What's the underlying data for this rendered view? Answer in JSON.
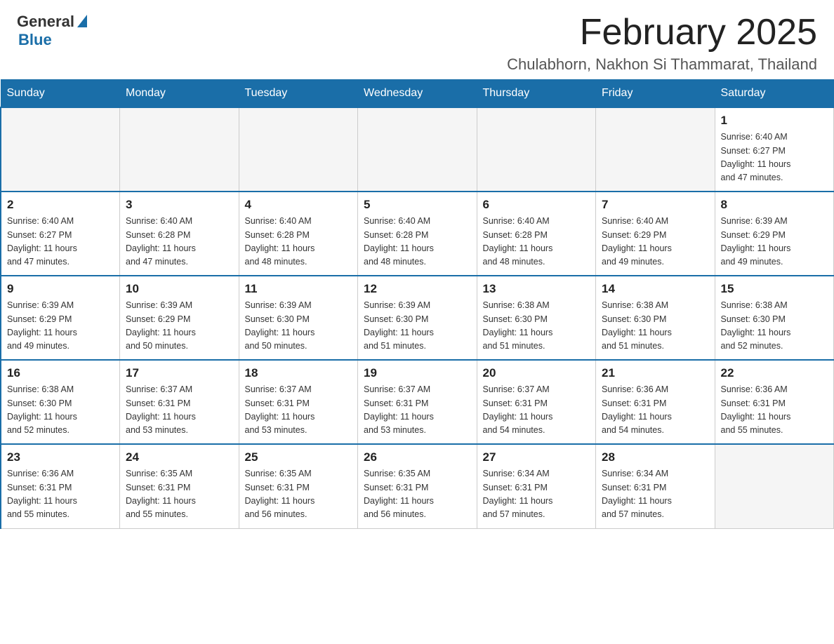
{
  "header": {
    "logo_general": "General",
    "logo_blue": "Blue",
    "month_year": "February 2025",
    "location": "Chulabhorn, Nakhon Si Thammarat, Thailand"
  },
  "days_of_week": [
    "Sunday",
    "Monday",
    "Tuesday",
    "Wednesday",
    "Thursday",
    "Friday",
    "Saturday"
  ],
  "weeks": [
    {
      "days": [
        {
          "number": "",
          "info": "",
          "empty": true
        },
        {
          "number": "",
          "info": "",
          "empty": true
        },
        {
          "number": "",
          "info": "",
          "empty": true
        },
        {
          "number": "",
          "info": "",
          "empty": true
        },
        {
          "number": "",
          "info": "",
          "empty": true
        },
        {
          "number": "",
          "info": "",
          "empty": true
        },
        {
          "number": "1",
          "info": "Sunrise: 6:40 AM\nSunset: 6:27 PM\nDaylight: 11 hours\nand 47 minutes."
        }
      ]
    },
    {
      "days": [
        {
          "number": "2",
          "info": "Sunrise: 6:40 AM\nSunset: 6:27 PM\nDaylight: 11 hours\nand 47 minutes."
        },
        {
          "number": "3",
          "info": "Sunrise: 6:40 AM\nSunset: 6:28 PM\nDaylight: 11 hours\nand 47 minutes."
        },
        {
          "number": "4",
          "info": "Sunrise: 6:40 AM\nSunset: 6:28 PM\nDaylight: 11 hours\nand 48 minutes."
        },
        {
          "number": "5",
          "info": "Sunrise: 6:40 AM\nSunset: 6:28 PM\nDaylight: 11 hours\nand 48 minutes."
        },
        {
          "number": "6",
          "info": "Sunrise: 6:40 AM\nSunset: 6:28 PM\nDaylight: 11 hours\nand 48 minutes."
        },
        {
          "number": "7",
          "info": "Sunrise: 6:40 AM\nSunset: 6:29 PM\nDaylight: 11 hours\nand 49 minutes."
        },
        {
          "number": "8",
          "info": "Sunrise: 6:39 AM\nSunset: 6:29 PM\nDaylight: 11 hours\nand 49 minutes."
        }
      ]
    },
    {
      "days": [
        {
          "number": "9",
          "info": "Sunrise: 6:39 AM\nSunset: 6:29 PM\nDaylight: 11 hours\nand 49 minutes."
        },
        {
          "number": "10",
          "info": "Sunrise: 6:39 AM\nSunset: 6:29 PM\nDaylight: 11 hours\nand 50 minutes."
        },
        {
          "number": "11",
          "info": "Sunrise: 6:39 AM\nSunset: 6:30 PM\nDaylight: 11 hours\nand 50 minutes."
        },
        {
          "number": "12",
          "info": "Sunrise: 6:39 AM\nSunset: 6:30 PM\nDaylight: 11 hours\nand 51 minutes."
        },
        {
          "number": "13",
          "info": "Sunrise: 6:38 AM\nSunset: 6:30 PM\nDaylight: 11 hours\nand 51 minutes."
        },
        {
          "number": "14",
          "info": "Sunrise: 6:38 AM\nSunset: 6:30 PM\nDaylight: 11 hours\nand 51 minutes."
        },
        {
          "number": "15",
          "info": "Sunrise: 6:38 AM\nSunset: 6:30 PM\nDaylight: 11 hours\nand 52 minutes."
        }
      ]
    },
    {
      "days": [
        {
          "number": "16",
          "info": "Sunrise: 6:38 AM\nSunset: 6:30 PM\nDaylight: 11 hours\nand 52 minutes."
        },
        {
          "number": "17",
          "info": "Sunrise: 6:37 AM\nSunset: 6:31 PM\nDaylight: 11 hours\nand 53 minutes."
        },
        {
          "number": "18",
          "info": "Sunrise: 6:37 AM\nSunset: 6:31 PM\nDaylight: 11 hours\nand 53 minutes."
        },
        {
          "number": "19",
          "info": "Sunrise: 6:37 AM\nSunset: 6:31 PM\nDaylight: 11 hours\nand 53 minutes."
        },
        {
          "number": "20",
          "info": "Sunrise: 6:37 AM\nSunset: 6:31 PM\nDaylight: 11 hours\nand 54 minutes."
        },
        {
          "number": "21",
          "info": "Sunrise: 6:36 AM\nSunset: 6:31 PM\nDaylight: 11 hours\nand 54 minutes."
        },
        {
          "number": "22",
          "info": "Sunrise: 6:36 AM\nSunset: 6:31 PM\nDaylight: 11 hours\nand 55 minutes."
        }
      ]
    },
    {
      "days": [
        {
          "number": "23",
          "info": "Sunrise: 6:36 AM\nSunset: 6:31 PM\nDaylight: 11 hours\nand 55 minutes."
        },
        {
          "number": "24",
          "info": "Sunrise: 6:35 AM\nSunset: 6:31 PM\nDaylight: 11 hours\nand 55 minutes."
        },
        {
          "number": "25",
          "info": "Sunrise: 6:35 AM\nSunset: 6:31 PM\nDaylight: 11 hours\nand 56 minutes."
        },
        {
          "number": "26",
          "info": "Sunrise: 6:35 AM\nSunset: 6:31 PM\nDaylight: 11 hours\nand 56 minutes."
        },
        {
          "number": "27",
          "info": "Sunrise: 6:34 AM\nSunset: 6:31 PM\nDaylight: 11 hours\nand 57 minutes."
        },
        {
          "number": "28",
          "info": "Sunrise: 6:34 AM\nSunset: 6:31 PM\nDaylight: 11 hours\nand 57 minutes."
        },
        {
          "number": "",
          "info": "",
          "empty": true
        }
      ]
    }
  ]
}
